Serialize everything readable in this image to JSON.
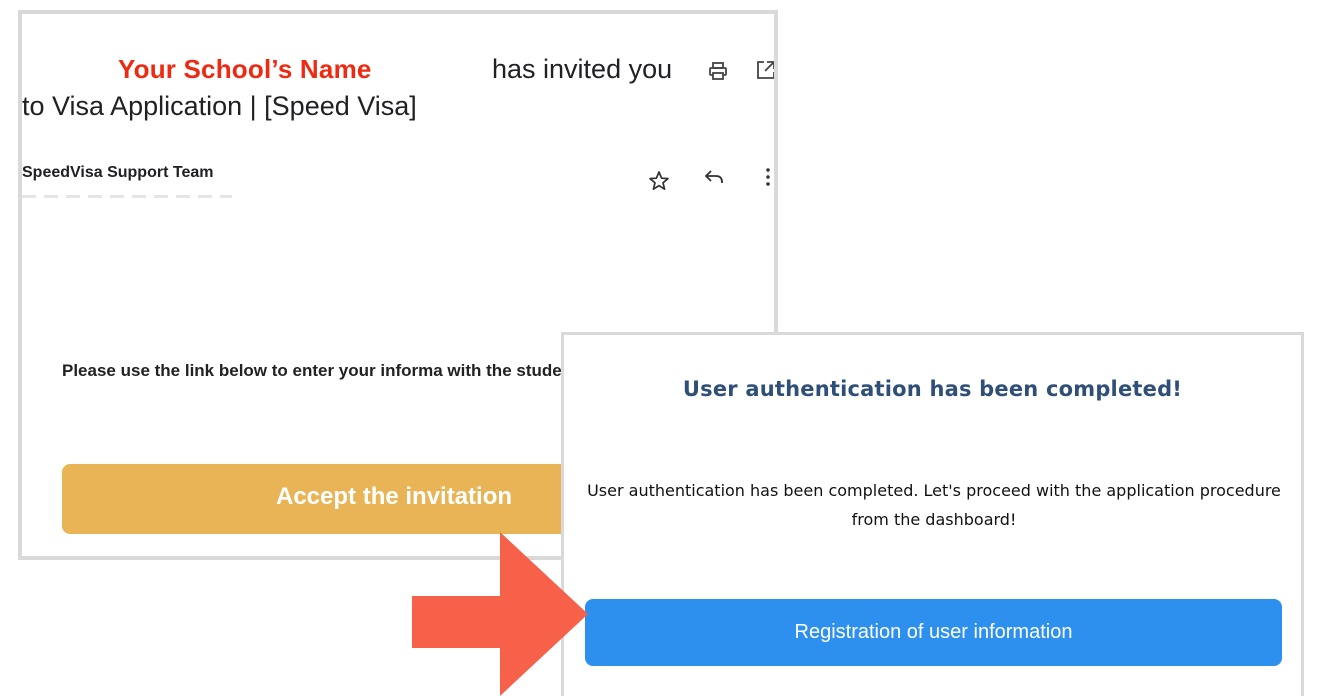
{
  "email": {
    "school_name": "Your School’s Name",
    "subject_part1": "has invited you",
    "subject_part2": "to Visa Application | [Speed Visa]",
    "sender": "SpeedVisa Support Team",
    "body_text": "Please use the link below to enter your informa with the student visa process.",
    "accept_button_label": "Accept the invitation",
    "icons": {
      "print": "print-icon",
      "open_new": "open-in-new-icon",
      "star": "star-icon",
      "reply": "reply-icon",
      "more": "more-vertical-icon"
    }
  },
  "confirmation": {
    "title": "User authentication has been completed!",
    "message": "User authentication has been completed. Let's proceed with the application procedure from the dashboard!",
    "register_button_label": "Registration of user information"
  },
  "colors": {
    "school_name": "#ee2a12",
    "accept_button": "#e9b456",
    "title": "#2f4f78",
    "register_button": "#2d8fee",
    "arrow": "#f7614a"
  }
}
